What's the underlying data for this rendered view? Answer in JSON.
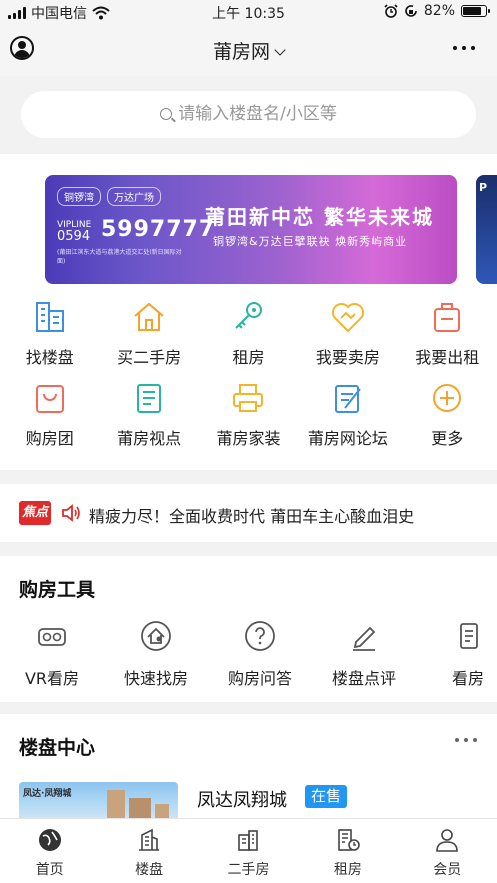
{
  "status_bar": {
    "carrier": "中国电信",
    "time": "上午 10:35",
    "battery": "82%",
    "battery_level": 0.82
  },
  "nav": {
    "title": "莆房网"
  },
  "search": {
    "placeholder": "请输入楼盘名/小区等"
  },
  "banner": {
    "logo_left": "铜锣湾",
    "logo_right": "万达广场",
    "vip_label": "VIPLINE",
    "area_code": "0594",
    "phone": "5997777",
    "address": "(莆田江滨东大道与荔港大道交汇处(新日国际对面)",
    "headline": "莆田新中芯 繁华未来城",
    "subline": "铜锣湾&万达巨擘联袂 焕新秀屿商业",
    "peek_text": "P"
  },
  "quick_menu": [
    {
      "label": "找楼盘",
      "icon": "building-icon",
      "color": "#3d8fe0"
    },
    {
      "label": "买二手房",
      "icon": "house-icon",
      "color": "#f3a42a"
    },
    {
      "label": "租房",
      "icon": "key-icon",
      "color": "#27b5a2"
    },
    {
      "label": "我要卖房",
      "icon": "handshake-heart-icon",
      "color": "#f3b62a"
    },
    {
      "label": "我要出租",
      "icon": "suitcase-icon",
      "color": "#f06c5a"
    },
    {
      "label": "购房团",
      "icon": "shopping-bag-icon",
      "color": "#f06c5a"
    },
    {
      "label": "莆房视点",
      "icon": "news-icon",
      "color": "#27b5a2"
    },
    {
      "label": "莆房家装",
      "icon": "printer-icon",
      "color": "#f3b62a"
    },
    {
      "label": "莆房网论坛",
      "icon": "edit-note-icon",
      "color": "#3d8fe0"
    },
    {
      "label": "更多",
      "icon": "plus-circle-icon",
      "color": "#f3a42a"
    }
  ],
  "news": {
    "badge": "焦点",
    "text": "精疲力尽！全面收费时代 莆田车主心酸血泪史"
  },
  "tools": {
    "title": "购房工具",
    "items": [
      {
        "label": "VR看房",
        "icon": "vr-glasses-icon"
      },
      {
        "label": "快速找房",
        "icon": "home-search-icon"
      },
      {
        "label": "购房问答",
        "icon": "question-circle-icon"
      },
      {
        "label": "楼盘点评",
        "icon": "pencil-review-icon"
      },
      {
        "label": "看房",
        "icon": "document-icon"
      }
    ]
  },
  "estates": {
    "title": "楼盘中心",
    "first": {
      "thumb_text": "凤达·凤翔城",
      "name": "凤达凤翔城",
      "status": "在售"
    }
  },
  "tabs": [
    {
      "label": "首页",
      "icon": "home-globe-icon",
      "active": true
    },
    {
      "label": "楼盘",
      "icon": "building-icon",
      "active": false
    },
    {
      "label": "二手房",
      "icon": "houses-icon",
      "active": false
    },
    {
      "label": "租房",
      "icon": "rent-building-icon",
      "active": false
    },
    {
      "label": "会员",
      "icon": "user-icon",
      "active": false
    }
  ]
}
